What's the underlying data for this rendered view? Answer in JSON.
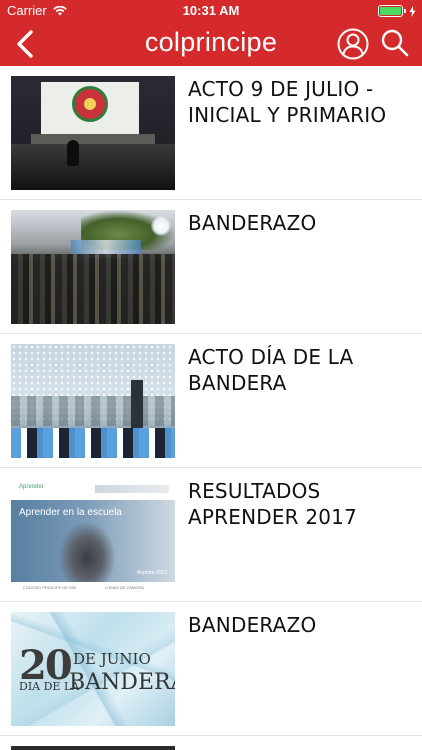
{
  "status_bar": {
    "carrier": "Carrier",
    "time": "10:31 AM",
    "battery_level": 1.0,
    "battery_color": "#4cd964"
  },
  "nav": {
    "title": "colprincipe",
    "back_icon": "chevron-left-icon",
    "user_icon": "user-icon",
    "search_icon": "search-icon"
  },
  "theme": {
    "header_bg": "#d42a2c",
    "text_color": "#111111"
  },
  "items": [
    {
      "title": "ACTO 9 DE JULIO - INICIAL Y PRIMARIO",
      "thumbnail": "projector-stage-photo"
    },
    {
      "title": "BANDERAZO",
      "thumbnail": "crowd-photo"
    },
    {
      "title": "ACTO DÍA DE LA BANDERA",
      "thumbnail": "flags-confetti-photo"
    },
    {
      "title": "RESULTADOS APRENDER 2017",
      "thumbnail": "report-cover",
      "cover": {
        "logo": "Aprender",
        "banner": "Aprender en la escuela",
        "report": "Reporte 2017",
        "footer_left": "COLEGIO PRINCIPE DE PAZ",
        "footer_right": "LOMAS DE ZAMORA"
      }
    },
    {
      "title": "BANDERAZO",
      "thumbnail": "flag-day-poster",
      "poster": {
        "day": "20",
        "month_prefix": "DE",
        "month": "JUNIO",
        "line2_a": "DIA DE LA",
        "line2_b": "BANDERA"
      }
    }
  ]
}
